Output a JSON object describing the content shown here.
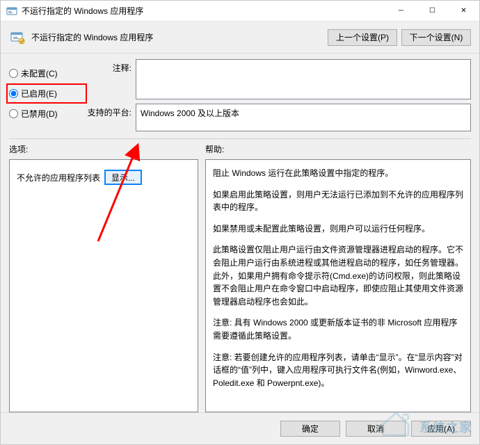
{
  "window": {
    "title": "不运行指定的 Windows 应用程序"
  },
  "header": {
    "policy_name": "不运行指定的 Windows 应用程序",
    "prev_button": "上一个设置(P)",
    "next_button": "下一个设置(N)"
  },
  "config": {
    "not_configured": "未配置(C)",
    "enabled": "已启用(E)",
    "disabled": "已禁用(D)",
    "selected": "enabled"
  },
  "meta": {
    "comment_label": "注释:",
    "comment_value": "",
    "supported_label": "支持的平台:",
    "supported_value": "Windows 2000 及以上版本"
  },
  "columns": {
    "options_label": "选项:",
    "help_label": "帮助:"
  },
  "options": {
    "list_label": "不允许的应用程序列表",
    "show_button": "显示..."
  },
  "help": {
    "p1": "阻止 Windows 运行在此策略设置中指定的程序。",
    "p2": "如果启用此策略设置，则用户无法运行已添加到不允许的应用程序列表中的程序。",
    "p3": "如果禁用或未配置此策略设置，则用户可以运行任何程序。",
    "p4": "此策略设置仅阻止用户运行由文件资源管理器进程启动的程序。它不会阻止用户运行由系统进程或其他进程启动的程序，如任务管理器。此外，如果用户拥有命令提示符(Cmd.exe)的访问权限，则此策略设置不会阻止用户在命令窗口中启动程序，即使应阻止其使用文件资源管理器启动程序也会如此。",
    "p5": "注意: 具有 Windows 2000 或更新版本证书的非 Microsoft 应用程序需要遵循此策略设置。",
    "p6": "注意: 若要创建允许的应用程序列表，请单击“显示”。在“显示内容”对话框的“值”列中，键入应用程序可执行文件名(例如，Winword.exe、Poledit.exe 和 Powerpnt.exe)。"
  },
  "footer": {
    "ok": "确定",
    "cancel": "取消",
    "apply": "应用(A)"
  },
  "watermark": {
    "text": "系统之家"
  }
}
